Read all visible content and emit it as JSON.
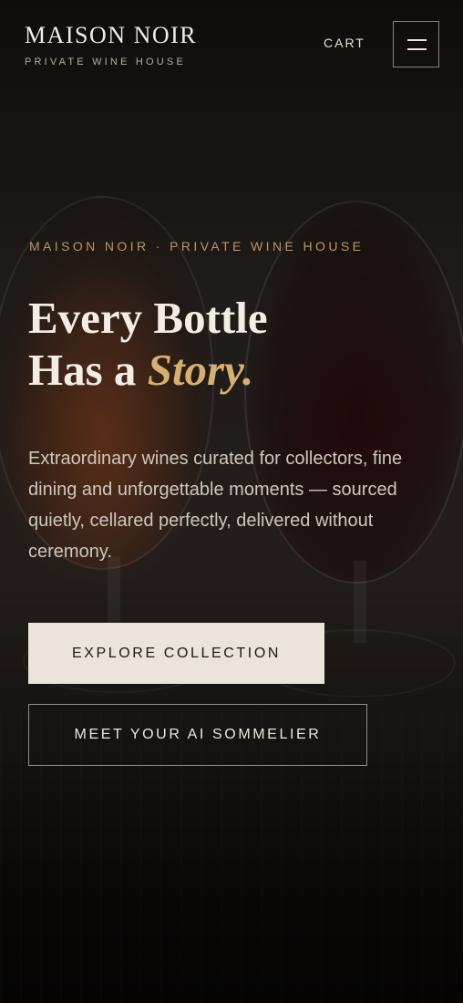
{
  "header": {
    "brand": "MAISON NOIR",
    "brand_subtitle": "PRIVATE WINE HOUSE",
    "cart_label": "CART",
    "menu_icon": "hamburger-menu-icon"
  },
  "hero": {
    "eyebrow": "MAISON NOIR · PRIVATE WINE HOUSE",
    "headline_line1": "Every Bottle",
    "headline_line2_prefix": "Has a ",
    "headline_accent": "Story.",
    "intro": "Extraordinary wines curated for collectors, fine dining and unforgettable moments — sourced quietly, cellared perfectly, delivered without ceremony.",
    "primary_cta": "EXPLORE COLLECTION",
    "secondary_cta": "MEET YOUR AI SOMMELIER"
  },
  "colors": {
    "accent_gold": "#d6b072",
    "eyebrow_gold": "#b9975e",
    "primary_button_bg": "#ebe4da",
    "background": "#1b1816"
  }
}
